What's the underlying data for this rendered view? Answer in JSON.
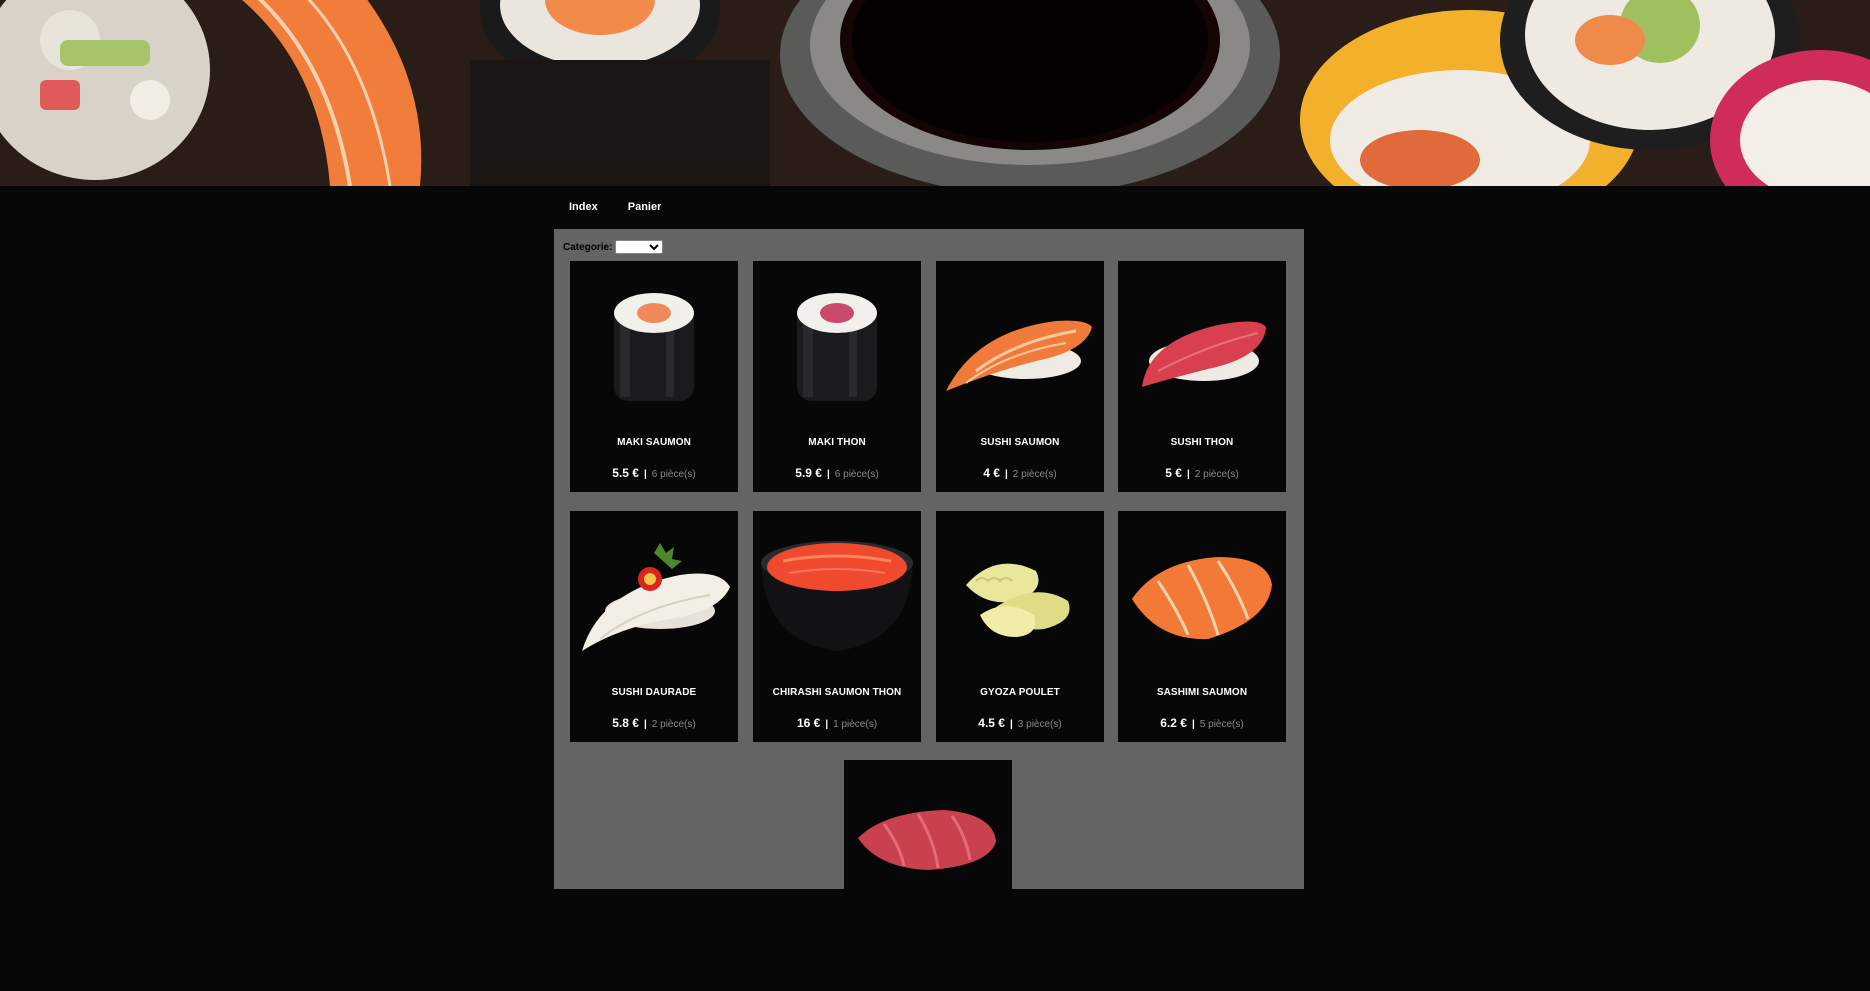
{
  "nav": {
    "items": [
      {
        "label": "Index"
      },
      {
        "label": "Panier"
      }
    ]
  },
  "filter": {
    "label": "Categorie:",
    "selected": ""
  },
  "products": [
    {
      "name": "MAKI SAUMON",
      "price": "5.5 €",
      "pieces": "6 pièce(s)",
      "icon": "maki-salmon"
    },
    {
      "name": "MAKI THON",
      "price": "5.9 €",
      "pieces": "6 pièce(s)",
      "icon": "maki-tuna"
    },
    {
      "name": "SUSHI SAUMON",
      "price": "4 €",
      "pieces": "2 pièce(s)",
      "icon": "nigiri-salmon"
    },
    {
      "name": "SUSHI THON",
      "price": "5 €",
      "pieces": "2 pièce(s)",
      "icon": "nigiri-tuna"
    },
    {
      "name": "SUSHI DAURADE",
      "price": "5.8 €",
      "pieces": "2 pièce(s)",
      "icon": "nigiri-seabream"
    },
    {
      "name": "CHIRASHI SAUMON THON",
      "price": "16 €",
      "pieces": "1 pièce(s)",
      "icon": "chirashi-bowl"
    },
    {
      "name": "GYOZA POULET",
      "price": "4.5 €",
      "pieces": "3 pièce(s)",
      "icon": "gyoza"
    },
    {
      "name": "SASHIMI SAUMON",
      "price": "6.2 €",
      "pieces": "5 pièce(s)",
      "icon": "sashimi-salmon"
    },
    {
      "name": "",
      "price": "",
      "pieces": "",
      "icon": "sashimi-tuna"
    }
  ],
  "colors": {
    "page_bg": "#070707",
    "panel_bg": "#646464",
    "card_bg": "#070707",
    "salmon": "#f07a3a",
    "tuna": "#d9404f"
  }
}
